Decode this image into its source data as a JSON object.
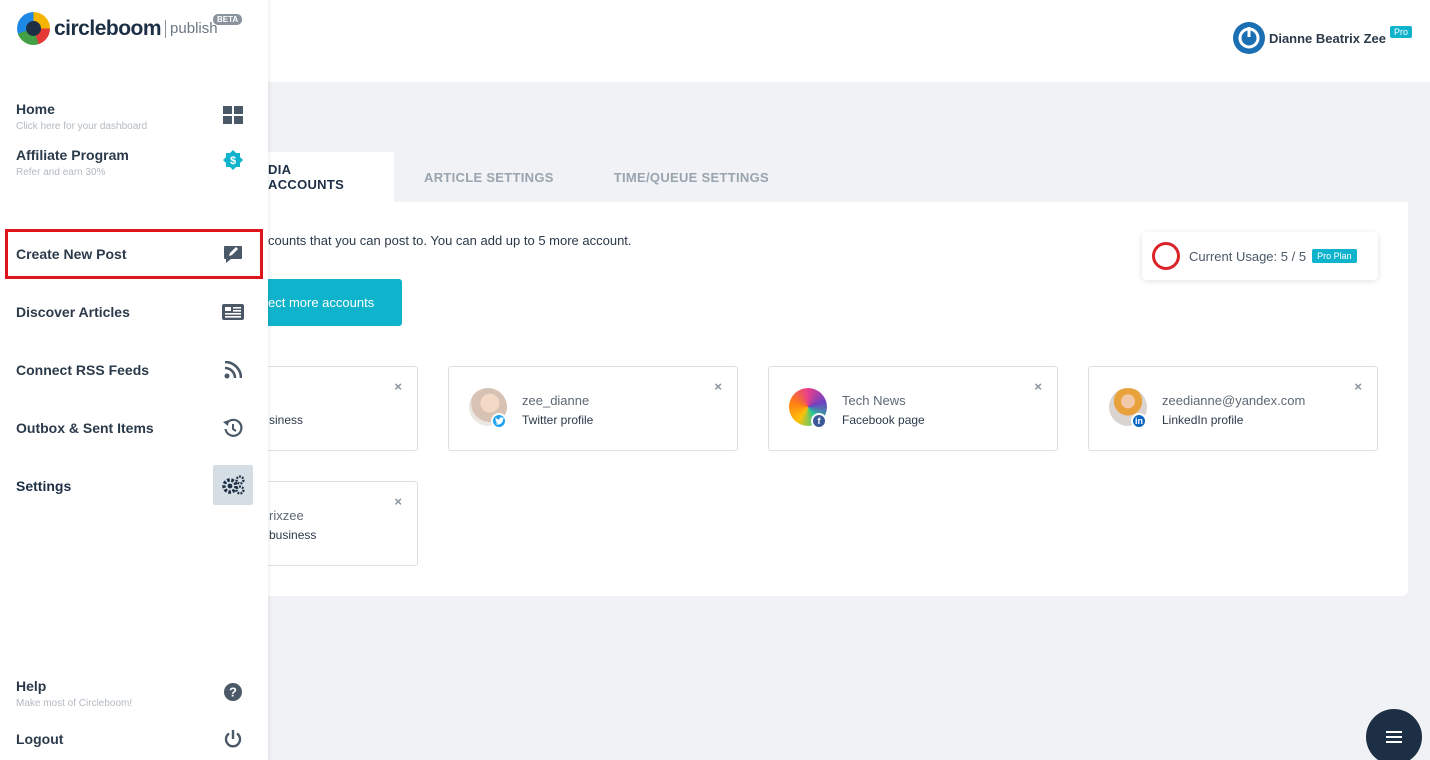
{
  "brand": {
    "name": "circleboom",
    "product": "publish",
    "badge": "BETA"
  },
  "user": {
    "name": "Dianne Beatrix Zee",
    "badge": "Pro"
  },
  "sidebar": {
    "home": {
      "label": "Home",
      "sub": "Click here for your dashboard"
    },
    "affiliate": {
      "label": "Affiliate Program",
      "sub": "Refer and earn 30%"
    },
    "create": {
      "label": "Create New Post"
    },
    "discover": {
      "label": "Discover Articles"
    },
    "rss": {
      "label": "Connect RSS Feeds"
    },
    "outbox": {
      "label": "Outbox & Sent Items"
    },
    "settings": {
      "label": "Settings"
    },
    "help": {
      "label": "Help",
      "sub": "Make most of Circleboom!"
    },
    "logout": {
      "label": "Logout"
    }
  },
  "tabs": [
    "DIA ACCOUNTS",
    "ARTICLE SETTINGS",
    "TIME/QUEUE SETTINGS"
  ],
  "panel": {
    "info": "counts that you can post to. You can add up to 5 more account.",
    "connect_button": "ect more accounts",
    "usage_label": "Current Usage: 5 / 5",
    "usage_plan": "Pro Plan",
    "usage_value": 5,
    "usage_max": 5
  },
  "accounts": [
    {
      "name": "",
      "type": "siness"
    },
    {
      "name": "zee_dianne",
      "type": "Twitter profile"
    },
    {
      "name": "Tech News",
      "type": "Facebook page"
    },
    {
      "name": "zeedianne@yandex.com",
      "type": "LinkedIn profile"
    },
    {
      "name": "rixzee",
      "type": "business"
    }
  ],
  "close_glyph": "×",
  "colors": {
    "accent": "#10b3cc",
    "navy": "#1c2f44",
    "highlight": "#e0141b",
    "twitter": "#1da1f2",
    "facebook": "#3b5998",
    "linkedin": "#0a66c2"
  }
}
